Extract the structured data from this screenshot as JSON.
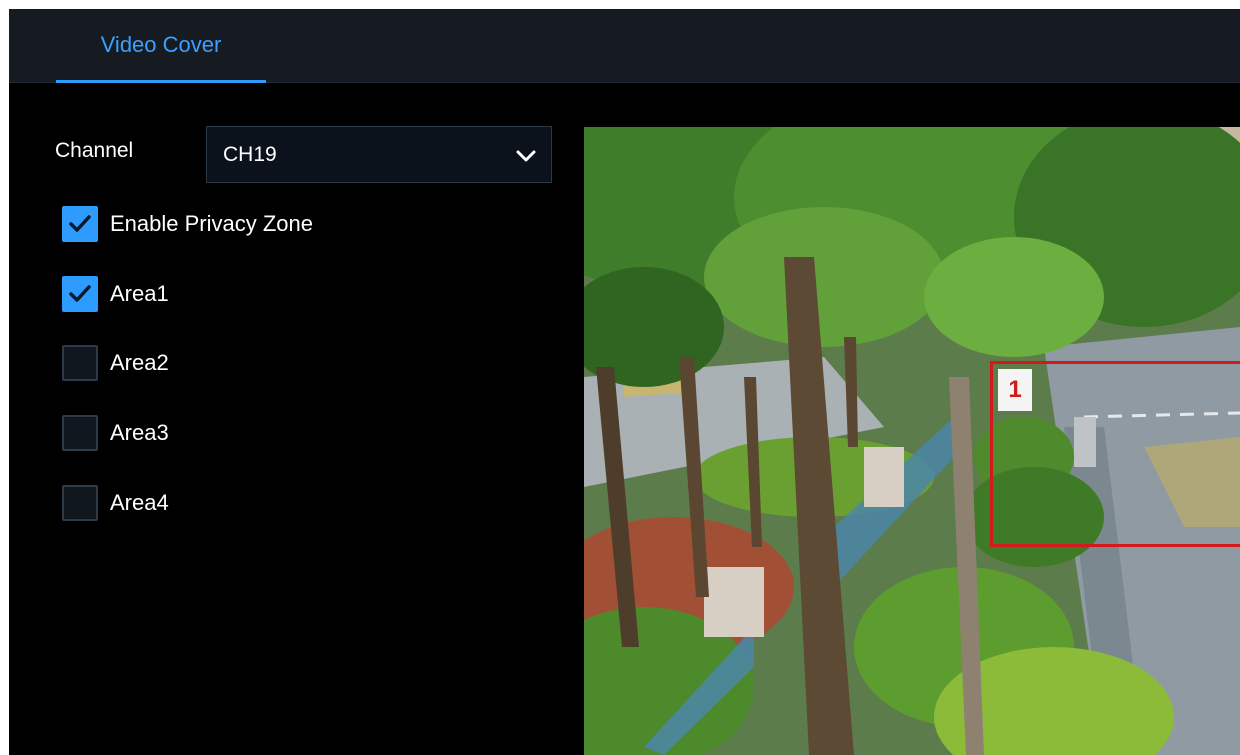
{
  "tabs": [
    {
      "label": "Video Cover",
      "active": true
    }
  ],
  "channel": {
    "label": "Channel",
    "selected": "CH19"
  },
  "options": [
    {
      "label": "Enable Privacy Zone",
      "checked": true
    },
    {
      "label": "Area1",
      "checked": true
    },
    {
      "label": "Area2",
      "checked": false
    },
    {
      "label": "Area3",
      "checked": false
    },
    {
      "label": "Area4",
      "checked": false
    }
  ],
  "preview": {
    "zones": [
      {
        "label": "1"
      }
    ]
  },
  "colors": {
    "accent": "#2e9bff",
    "zone": "#d2191c",
    "background": "#000000",
    "tabbar": "#161b22"
  },
  "icons": {
    "dropdown": "chevron-down-icon",
    "checked": "checkmark-icon"
  }
}
